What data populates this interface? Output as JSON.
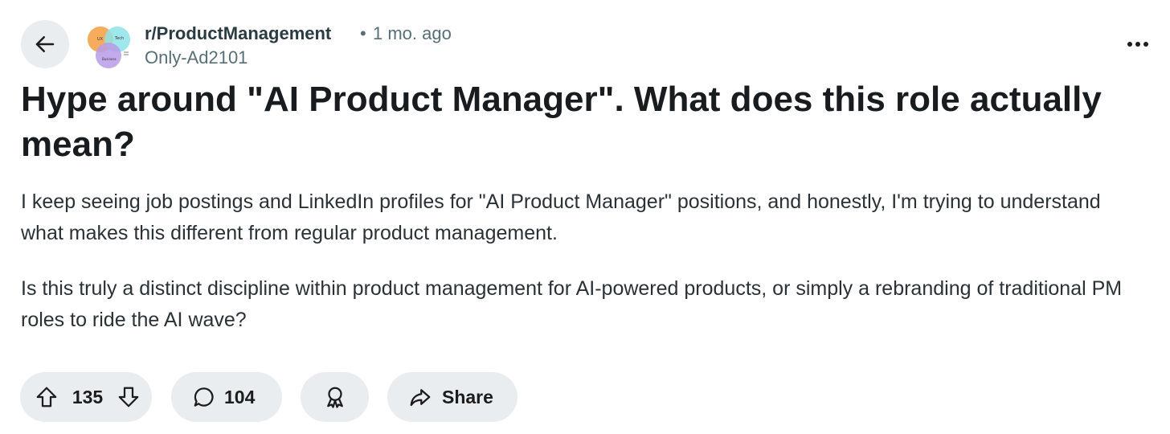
{
  "header": {
    "back_icon": "arrow-left-icon",
    "subreddit": "r/ProductManagement",
    "separator": "•",
    "time_ago": "1 mo. ago",
    "author": "Only-Ad2101",
    "more_icon": "more-horizontal-icon",
    "avatar_labels": [
      "UX",
      "Tech",
      "Business"
    ]
  },
  "post": {
    "title": "Hype around \"AI Product Manager\". What does this role actually mean?",
    "paragraphs": [
      "I keep seeing job postings and LinkedIn profiles for \"AI Product Manager\" positions, and honestly, I'm trying to understand what makes this different from regular product management.",
      "Is this truly a distinct discipline within product management for AI-powered products, or simply a rebranding of traditional PM roles to ride the AI wave?"
    ]
  },
  "actions": {
    "upvote_icon": "upvote-arrow-icon",
    "vote_count": "135",
    "downvote_icon": "downvote-arrow-icon",
    "comment_icon": "comment-bubble-icon",
    "comment_count": "104",
    "award_icon": "award-icon",
    "share_icon": "share-arrow-icon",
    "share_label": "Share"
  },
  "colors": {
    "pill_background": "#eaedef",
    "meta_text": "#576f76",
    "title_text": "#181c1f"
  }
}
